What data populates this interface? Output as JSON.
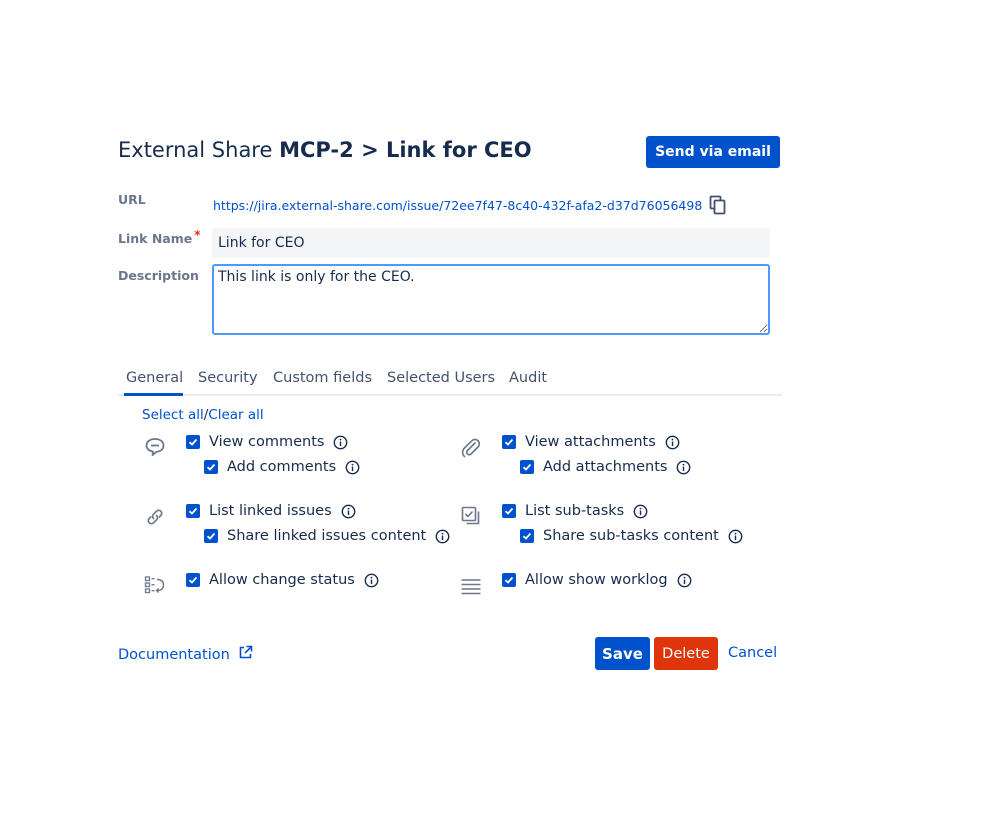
{
  "header": {
    "title_prefix": "External Share",
    "title_bold": "MCP-2 > Link for CEO",
    "send_email_label": "Send via email"
  },
  "form": {
    "url_label": "URL",
    "url_value": "https://jira.external-share.com/issue/72ee7f47-8c40-432f-afa2-d37d76056498",
    "link_name_label": "Link Name",
    "required_marker": "*",
    "link_name_value": "Link for CEO",
    "description_label": "Description",
    "description_value": "This link is only for the CEO."
  },
  "tabs": [
    "General",
    "Security",
    "Custom fields",
    "Selected Users",
    "Audit"
  ],
  "active_tab": "General",
  "select_all_label": "Select all",
  "separator": "/",
  "clear_all_label": "Clear all",
  "permissions": {
    "view_comments": "View comments",
    "add_comments": "Add comments",
    "view_attachments": "View attachments",
    "add_attachments": "Add attachments",
    "list_linked_issues": "List linked issues",
    "share_linked_issues_content": "Share linked issues content",
    "list_sub_tasks": "List sub-tasks",
    "share_sub_tasks_content": "Share sub-tasks content",
    "allow_change_status": "Allow change status",
    "allow_show_worklog": "Allow show worklog"
  },
  "footer": {
    "documentation_label": "Documentation",
    "save_label": "Save",
    "delete_label": "Delete",
    "cancel_label": "Cancel"
  },
  "colors": {
    "primary": "#0052cc",
    "danger": "#de350b",
    "text": "#172b4d",
    "muted": "#6b778c",
    "focus": "#4c9aff"
  }
}
